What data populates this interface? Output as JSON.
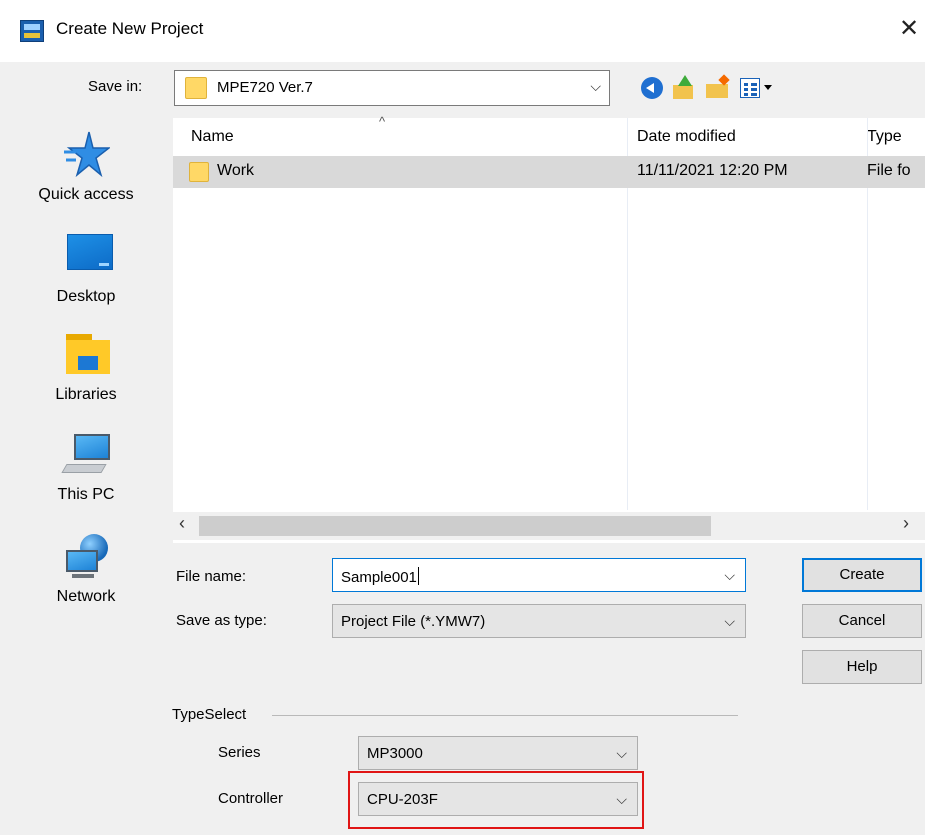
{
  "window": {
    "title": "Create New Project",
    "close_glyph": "✕"
  },
  "save_in": {
    "label": "Save in:",
    "value": "MPE720 Ver.7",
    "arrow": "⌵"
  },
  "toolbar": {
    "icons": [
      "back-icon",
      "up-folder-icon",
      "new-folder-icon",
      "view-menu-icon"
    ]
  },
  "places": [
    {
      "label": "Quick access",
      "icon": "star-icon"
    },
    {
      "label": "Desktop",
      "icon": "desktop-icon"
    },
    {
      "label": "Libraries",
      "icon": "libraries-icon"
    },
    {
      "label": "This PC",
      "icon": "computer-icon"
    },
    {
      "label": "Network",
      "icon": "network-icon"
    }
  ],
  "file_list": {
    "columns": [
      "Name",
      "Date modified",
      "Type"
    ],
    "sort_glyph": "^",
    "rows": [
      {
        "name": "Work",
        "date": "11/11/2021 12:20 PM",
        "type": "File fo"
      }
    ],
    "scroll_left": "‹",
    "scroll_right": "›"
  },
  "form": {
    "file_name_label": "File name:",
    "file_name_value": "Sample001",
    "save_type_label": "Save as type:",
    "save_type_value": "Project File (*.YMW7)",
    "arrow": "⌵"
  },
  "buttons": {
    "create": "Create",
    "cancel": "Cancel",
    "help": "Help"
  },
  "type_select": {
    "title": "TypeSelect",
    "series_label": "Series",
    "series_value": "MP3000",
    "controller_label": "Controller",
    "controller_value": "CPU-203F"
  },
  "colors": {
    "focus_blue": "#0078d7",
    "highlight_red": "#e01515",
    "selection_gray": "#d9d9d9"
  }
}
